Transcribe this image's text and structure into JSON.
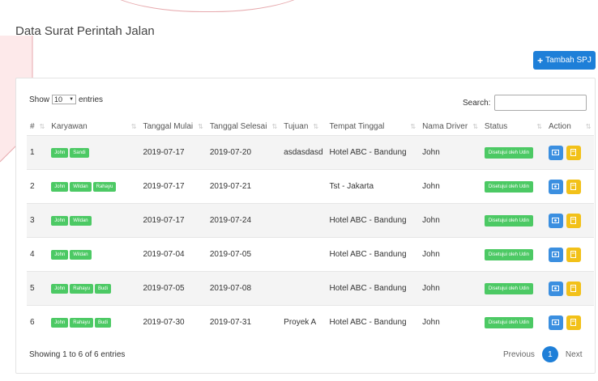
{
  "page": {
    "title": "Data Surat Perintah Jalan"
  },
  "toolbar": {
    "add_label": "Tambah SPJ"
  },
  "controls": {
    "show_label": "Show",
    "entries_value": "10",
    "entries_label": "entries",
    "search_label": "Search:",
    "search_value": ""
  },
  "table": {
    "headers": [
      "#",
      "Karyawan",
      "Tanggal Mulai",
      "Tanggal Selesai",
      "Tujuan",
      "Tempat Tinggal",
      "Nama Driver",
      "Status",
      "Action"
    ],
    "rows": [
      {
        "no": "1",
        "karyawan": [
          "John",
          "Sandi"
        ],
        "mulai": "2019-07-17",
        "selesai": "2019-07-20",
        "tujuan": "asdasdasd",
        "tempat": "Hotel ABC - Bandung",
        "driver": "John",
        "status": "Disetujui oleh Udin"
      },
      {
        "no": "2",
        "karyawan": [
          "John",
          "Wildan",
          "Rahayu"
        ],
        "mulai": "2019-07-17",
        "selesai": "2019-07-21",
        "tujuan": "",
        "tempat": "Tst - Jakarta",
        "driver": "John",
        "status": "Disetujui oleh Udin"
      },
      {
        "no": "3",
        "karyawan": [
          "John",
          "Wildan"
        ],
        "mulai": "2019-07-17",
        "selesai": "2019-07-24",
        "tujuan": "",
        "tempat": "Hotel ABC - Bandung",
        "driver": "John",
        "status": "Disetujui oleh Udin"
      },
      {
        "no": "4",
        "karyawan": [
          "John",
          "Wildan"
        ],
        "mulai": "2019-07-04",
        "selesai": "2019-07-05",
        "tujuan": "",
        "tempat": "Hotel ABC - Bandung",
        "driver": "John",
        "status": "Disetujui oleh Udin"
      },
      {
        "no": "5",
        "karyawan": [
          "John",
          "Rahayu",
          "Budi"
        ],
        "mulai": "2019-07-05",
        "selesai": "2019-07-08",
        "tujuan": "",
        "tempat": "Hotel ABC - Bandung",
        "driver": "John",
        "status": "Disetujui oleh Udin"
      },
      {
        "no": "6",
        "karyawan": [
          "John",
          "Rahayu",
          "Budi"
        ],
        "mulai": "2019-07-30",
        "selesai": "2019-07-31",
        "tujuan": "Proyek A",
        "tempat": "Hotel ABC - Bandung",
        "driver": "John",
        "status": "Disetujui oleh Udin"
      }
    ]
  },
  "footer": {
    "info": "Showing 1 to 6 of 6 entries",
    "previous": "Previous",
    "page": "1",
    "next": "Next"
  },
  "icons": {
    "add": "plus-icon",
    "view": "eye-icon",
    "edit": "file-icon",
    "sort": "sort-icon",
    "dropdown": "caret-down-icon"
  },
  "colors": {
    "primary": "#1e7fd8",
    "success": "#4cc964",
    "warning": "#f2c119",
    "info": "#3b8fe0",
    "decor": "#e7a9ad"
  }
}
